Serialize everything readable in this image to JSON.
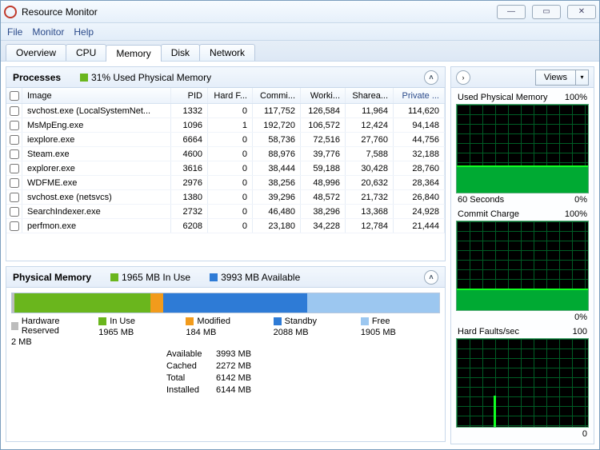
{
  "window": {
    "title": "Resource Monitor"
  },
  "menu": {
    "file": "File",
    "monitor": "Monitor",
    "help": "Help"
  },
  "tabs": {
    "overview": "Overview",
    "cpu": "CPU",
    "memory": "Memory",
    "disk": "Disk",
    "network": "Network",
    "active": "memory"
  },
  "processes": {
    "title": "Processes",
    "usage_text": "31% Used Physical Memory",
    "columns": {
      "image": "Image",
      "pid": "PID",
      "hard": "Hard F...",
      "commit": "Commi...",
      "work": "Worki...",
      "share": "Sharea...",
      "priv": "Private ..."
    },
    "rows": [
      {
        "image": "svchost.exe (LocalSystemNet...",
        "pid": "1332",
        "hf": "0",
        "commit": "117,752",
        "work": "126,584",
        "share": "11,964",
        "priv": "114,620"
      },
      {
        "image": "MsMpEng.exe",
        "pid": "1096",
        "hf": "1",
        "commit": "192,720",
        "work": "106,572",
        "share": "12,424",
        "priv": "94,148"
      },
      {
        "image": "iexplore.exe",
        "pid": "6664",
        "hf": "0",
        "commit": "58,736",
        "work": "72,516",
        "share": "27,760",
        "priv": "44,756"
      },
      {
        "image": "Steam.exe",
        "pid": "4600",
        "hf": "0",
        "commit": "88,976",
        "work": "39,776",
        "share": "7,588",
        "priv": "32,188"
      },
      {
        "image": "explorer.exe",
        "pid": "3616",
        "hf": "0",
        "commit": "38,444",
        "work": "59,188",
        "share": "30,428",
        "priv": "28,760"
      },
      {
        "image": "WDFME.exe",
        "pid": "2976",
        "hf": "0",
        "commit": "38,256",
        "work": "48,996",
        "share": "20,632",
        "priv": "28,364"
      },
      {
        "image": "svchost.exe (netsvcs)",
        "pid": "1380",
        "hf": "0",
        "commit": "39,296",
        "work": "48,572",
        "share": "21,732",
        "priv": "26,840"
      },
      {
        "image": "SearchIndexer.exe",
        "pid": "2732",
        "hf": "0",
        "commit": "46,480",
        "work": "38,296",
        "share": "13,368",
        "priv": "24,928"
      },
      {
        "image": "perfmon.exe",
        "pid": "6208",
        "hf": "0",
        "commit": "23,180",
        "work": "34,228",
        "share": "12,784",
        "priv": "21,444"
      }
    ]
  },
  "physmem": {
    "title": "Physical Memory",
    "inuse_label": "1965 MB In Use",
    "avail_label": "3993 MB Available",
    "segments": [
      {
        "name": "Hardware Reserved",
        "value": "2 MB",
        "color": "#bdbdbd",
        "flex": 0.5
      },
      {
        "name": "In Use",
        "value": "1965 MB",
        "color": "#6ab61d",
        "flex": 32
      },
      {
        "name": "Modified",
        "value": "184 MB",
        "color": "#f29b1c",
        "flex": 3
      },
      {
        "name": "Standby",
        "value": "2088 MB",
        "color": "#2e7bd6",
        "flex": 34
      },
      {
        "name": "Free",
        "value": "1905 MB",
        "color": "#9cc7f0",
        "flex": 31
      }
    ],
    "stats": [
      {
        "k": "Available",
        "v": "3993 MB"
      },
      {
        "k": "Cached",
        "v": "2272 MB"
      },
      {
        "k": "Total",
        "v": "6142 MB"
      },
      {
        "k": "Installed",
        "v": "6144 MB"
      }
    ]
  },
  "right": {
    "views_label": "Views",
    "graphs": [
      {
        "title": "Used Physical Memory",
        "right": "100%",
        "foot_l": "60 Seconds",
        "foot_r": "0%",
        "fill_pct": 31
      },
      {
        "title": "Commit Charge",
        "right": "100%",
        "foot_l": "",
        "foot_r": "0%",
        "fill_pct": 24
      },
      {
        "title": "Hard Faults/sec",
        "right": "100",
        "foot_l": "",
        "foot_r": "0",
        "fill_pct": 0,
        "spike": true
      }
    ]
  }
}
